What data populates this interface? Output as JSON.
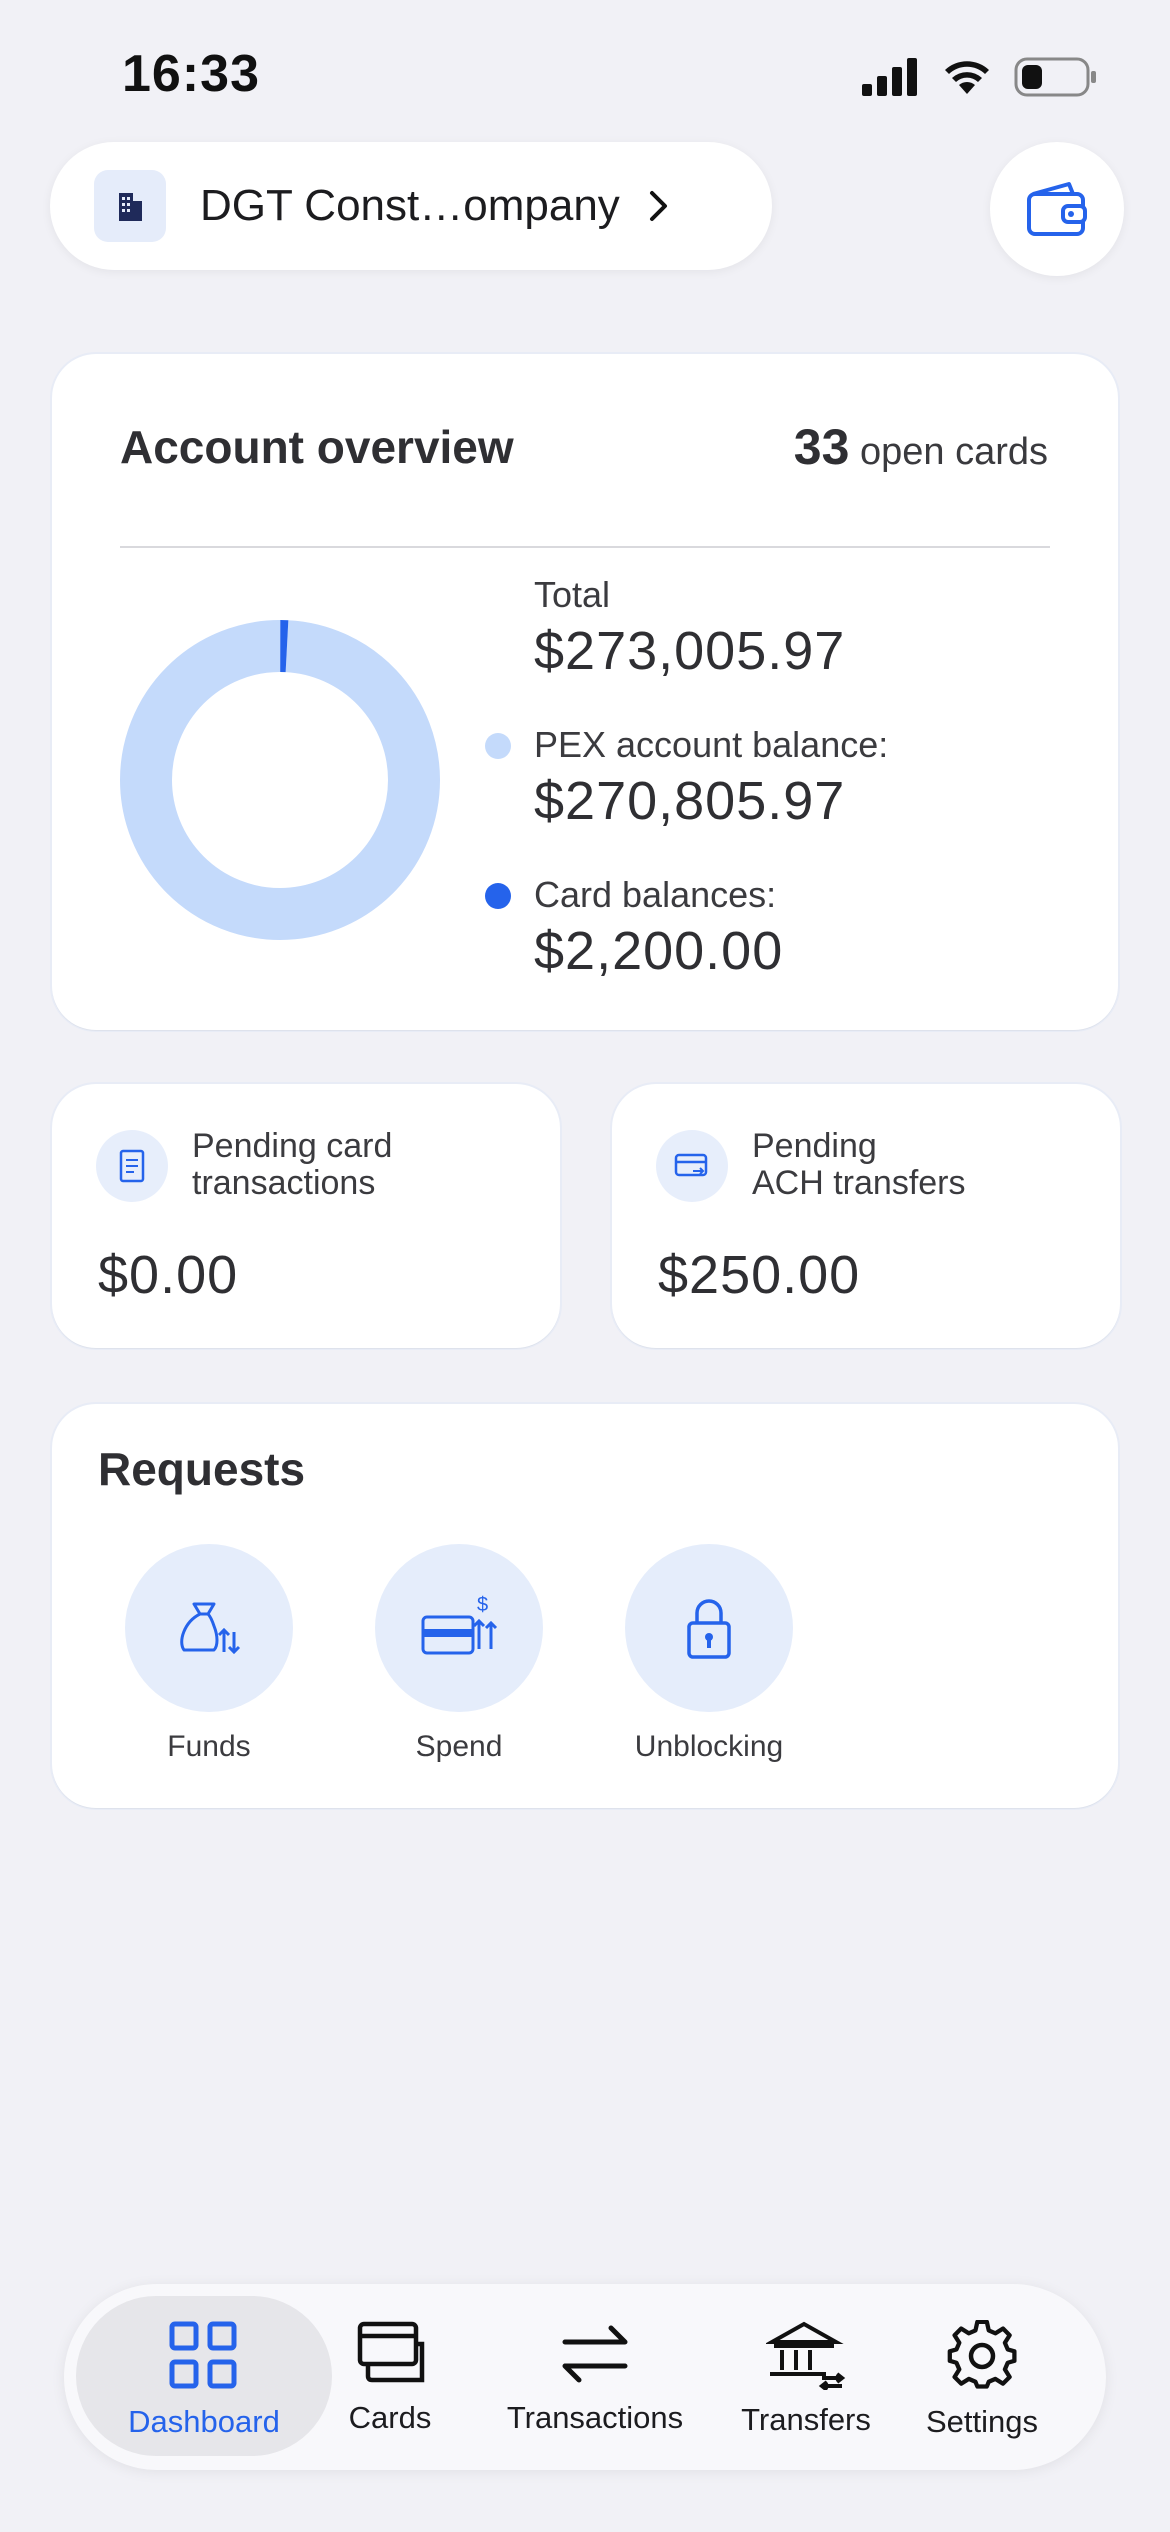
{
  "status_bar": {
    "time": "16:33"
  },
  "header": {
    "company_name": "DGT Const…ompany"
  },
  "overview": {
    "title": "Account overview",
    "open_cards_count": "33",
    "open_cards_label": "open cards",
    "total_label": "Total",
    "total_value": "$273,005.97",
    "pex_label": "PEX account balance:",
    "pex_value": "$270,805.97",
    "card_label": "Card balances:",
    "card_value": "$2,200.00",
    "colors": {
      "pex": "#c4dafb",
      "cards": "#2563eb"
    }
  },
  "chart_data": {
    "type": "pie",
    "labels": [
      "PEX account balance:",
      "Card balances:"
    ],
    "values": [
      270805.97,
      2200.0
    ],
    "colors": [
      "#c4dafb",
      "#2563eb"
    ]
  },
  "pending": {
    "card_transactions": {
      "label_line1": "Pending card",
      "label_line2": "transactions",
      "value": "$0.00",
      "icon": "receipt-icon"
    },
    "ach_transfers": {
      "label_line1": "Pending",
      "label_line2": "ACH transfers",
      "value": "$250.00",
      "icon": "card-transfer-icon"
    }
  },
  "requests": {
    "title": "Requests",
    "items": [
      {
        "label": "Funds",
        "icon": "money-bag-icon"
      },
      {
        "label": "Spend",
        "icon": "card-dollar-icon"
      },
      {
        "label": "Unblocking",
        "icon": "lock-icon"
      }
    ]
  },
  "tabbar": {
    "active": "Dashboard",
    "items": [
      {
        "label": "Dashboard",
        "icon": "dashboard-icon"
      },
      {
        "label": "Cards",
        "icon": "cards-icon"
      },
      {
        "label": "Transactions",
        "icon": "arrows-icon"
      },
      {
        "label": "Transfers",
        "icon": "bank-icon"
      },
      {
        "label": "Settings",
        "icon": "gear-icon"
      }
    ]
  }
}
